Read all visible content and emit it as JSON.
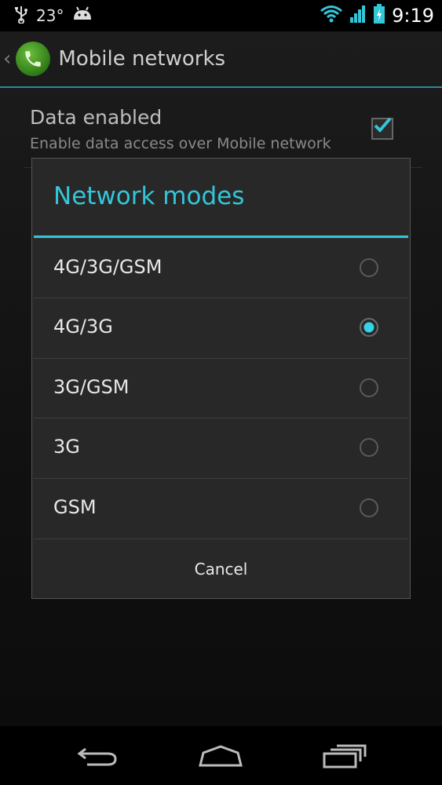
{
  "status_bar": {
    "temperature": "23°",
    "time": "9:19"
  },
  "action_bar": {
    "title": "Mobile networks"
  },
  "background_setting": {
    "title": "Data enabled",
    "summary": "Enable data access over Mobile network",
    "checked": true
  },
  "dialog": {
    "title": "Network modes",
    "options": [
      {
        "label": "4G/3G/GSM",
        "selected": false
      },
      {
        "label": "4G/3G",
        "selected": true
      },
      {
        "label": "3G/GSM",
        "selected": false
      },
      {
        "label": "3G",
        "selected": false
      },
      {
        "label": "GSM",
        "selected": false
      }
    ],
    "cancel_label": "Cancel"
  },
  "colors": {
    "accent": "#33c6d8",
    "dialog_bg": "#282828"
  },
  "icons": [
    "usb-icon",
    "android-icon",
    "wifi-icon",
    "signal-icon",
    "battery-icon",
    "back-icon",
    "home-icon",
    "recents-icon",
    "phone-icon"
  ]
}
